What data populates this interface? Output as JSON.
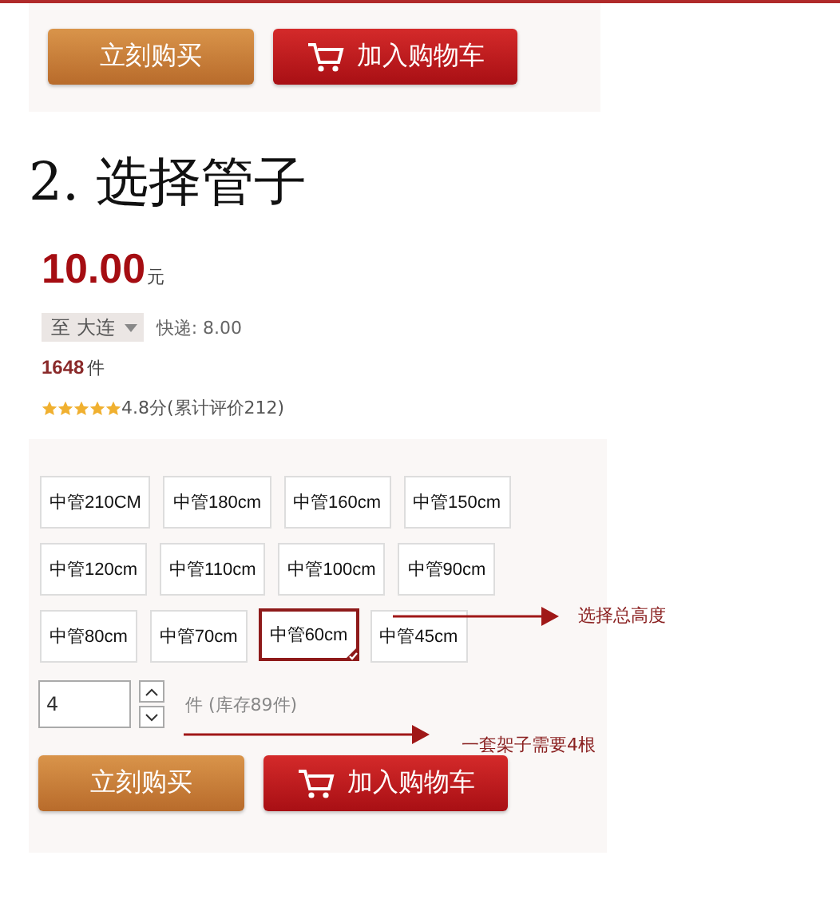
{
  "top_buttons": [
    {
      "kind": "buy",
      "label": "立刻购买"
    },
    {
      "kind": "cart",
      "label": "加入购物车"
    }
  ],
  "heading": "2. 选择管子",
  "price": {
    "amount": "10.00",
    "unit": "元"
  },
  "shipping": {
    "destination": "至 大连",
    "fee": "快递: 8.00"
  },
  "sales": {
    "count": "1648",
    "unit": "件"
  },
  "rating": {
    "stars": 5,
    "text": "4.8分(累计评价212)"
  },
  "options": [
    {
      "label": "中管210CM",
      "selected": false
    },
    {
      "label": "中管180cm",
      "selected": false
    },
    {
      "label": "中管160cm",
      "selected": false
    },
    {
      "label": "中管150cm",
      "selected": false
    },
    {
      "label": "中管120cm",
      "selected": false
    },
    {
      "label": "中管110cm",
      "selected": false
    },
    {
      "label": "中管100cm",
      "selected": false
    },
    {
      "label": "中管90cm",
      "selected": false
    },
    {
      "label": "中管80cm",
      "selected": false
    },
    {
      "label": "中管70cm",
      "selected": false
    },
    {
      "label": "中管60cm",
      "selected": true
    },
    {
      "label": "中管45cm",
      "selected": false
    }
  ],
  "option_note": "选择总高度",
  "quantity": {
    "value": "4",
    "stock": "件 (库存89件)",
    "note": "一套架子需要4根"
  },
  "bottom_buttons": [
    {
      "kind": "buy",
      "label": "立刻购买"
    },
    {
      "kind": "cart",
      "label": "加入购物车"
    }
  ]
}
